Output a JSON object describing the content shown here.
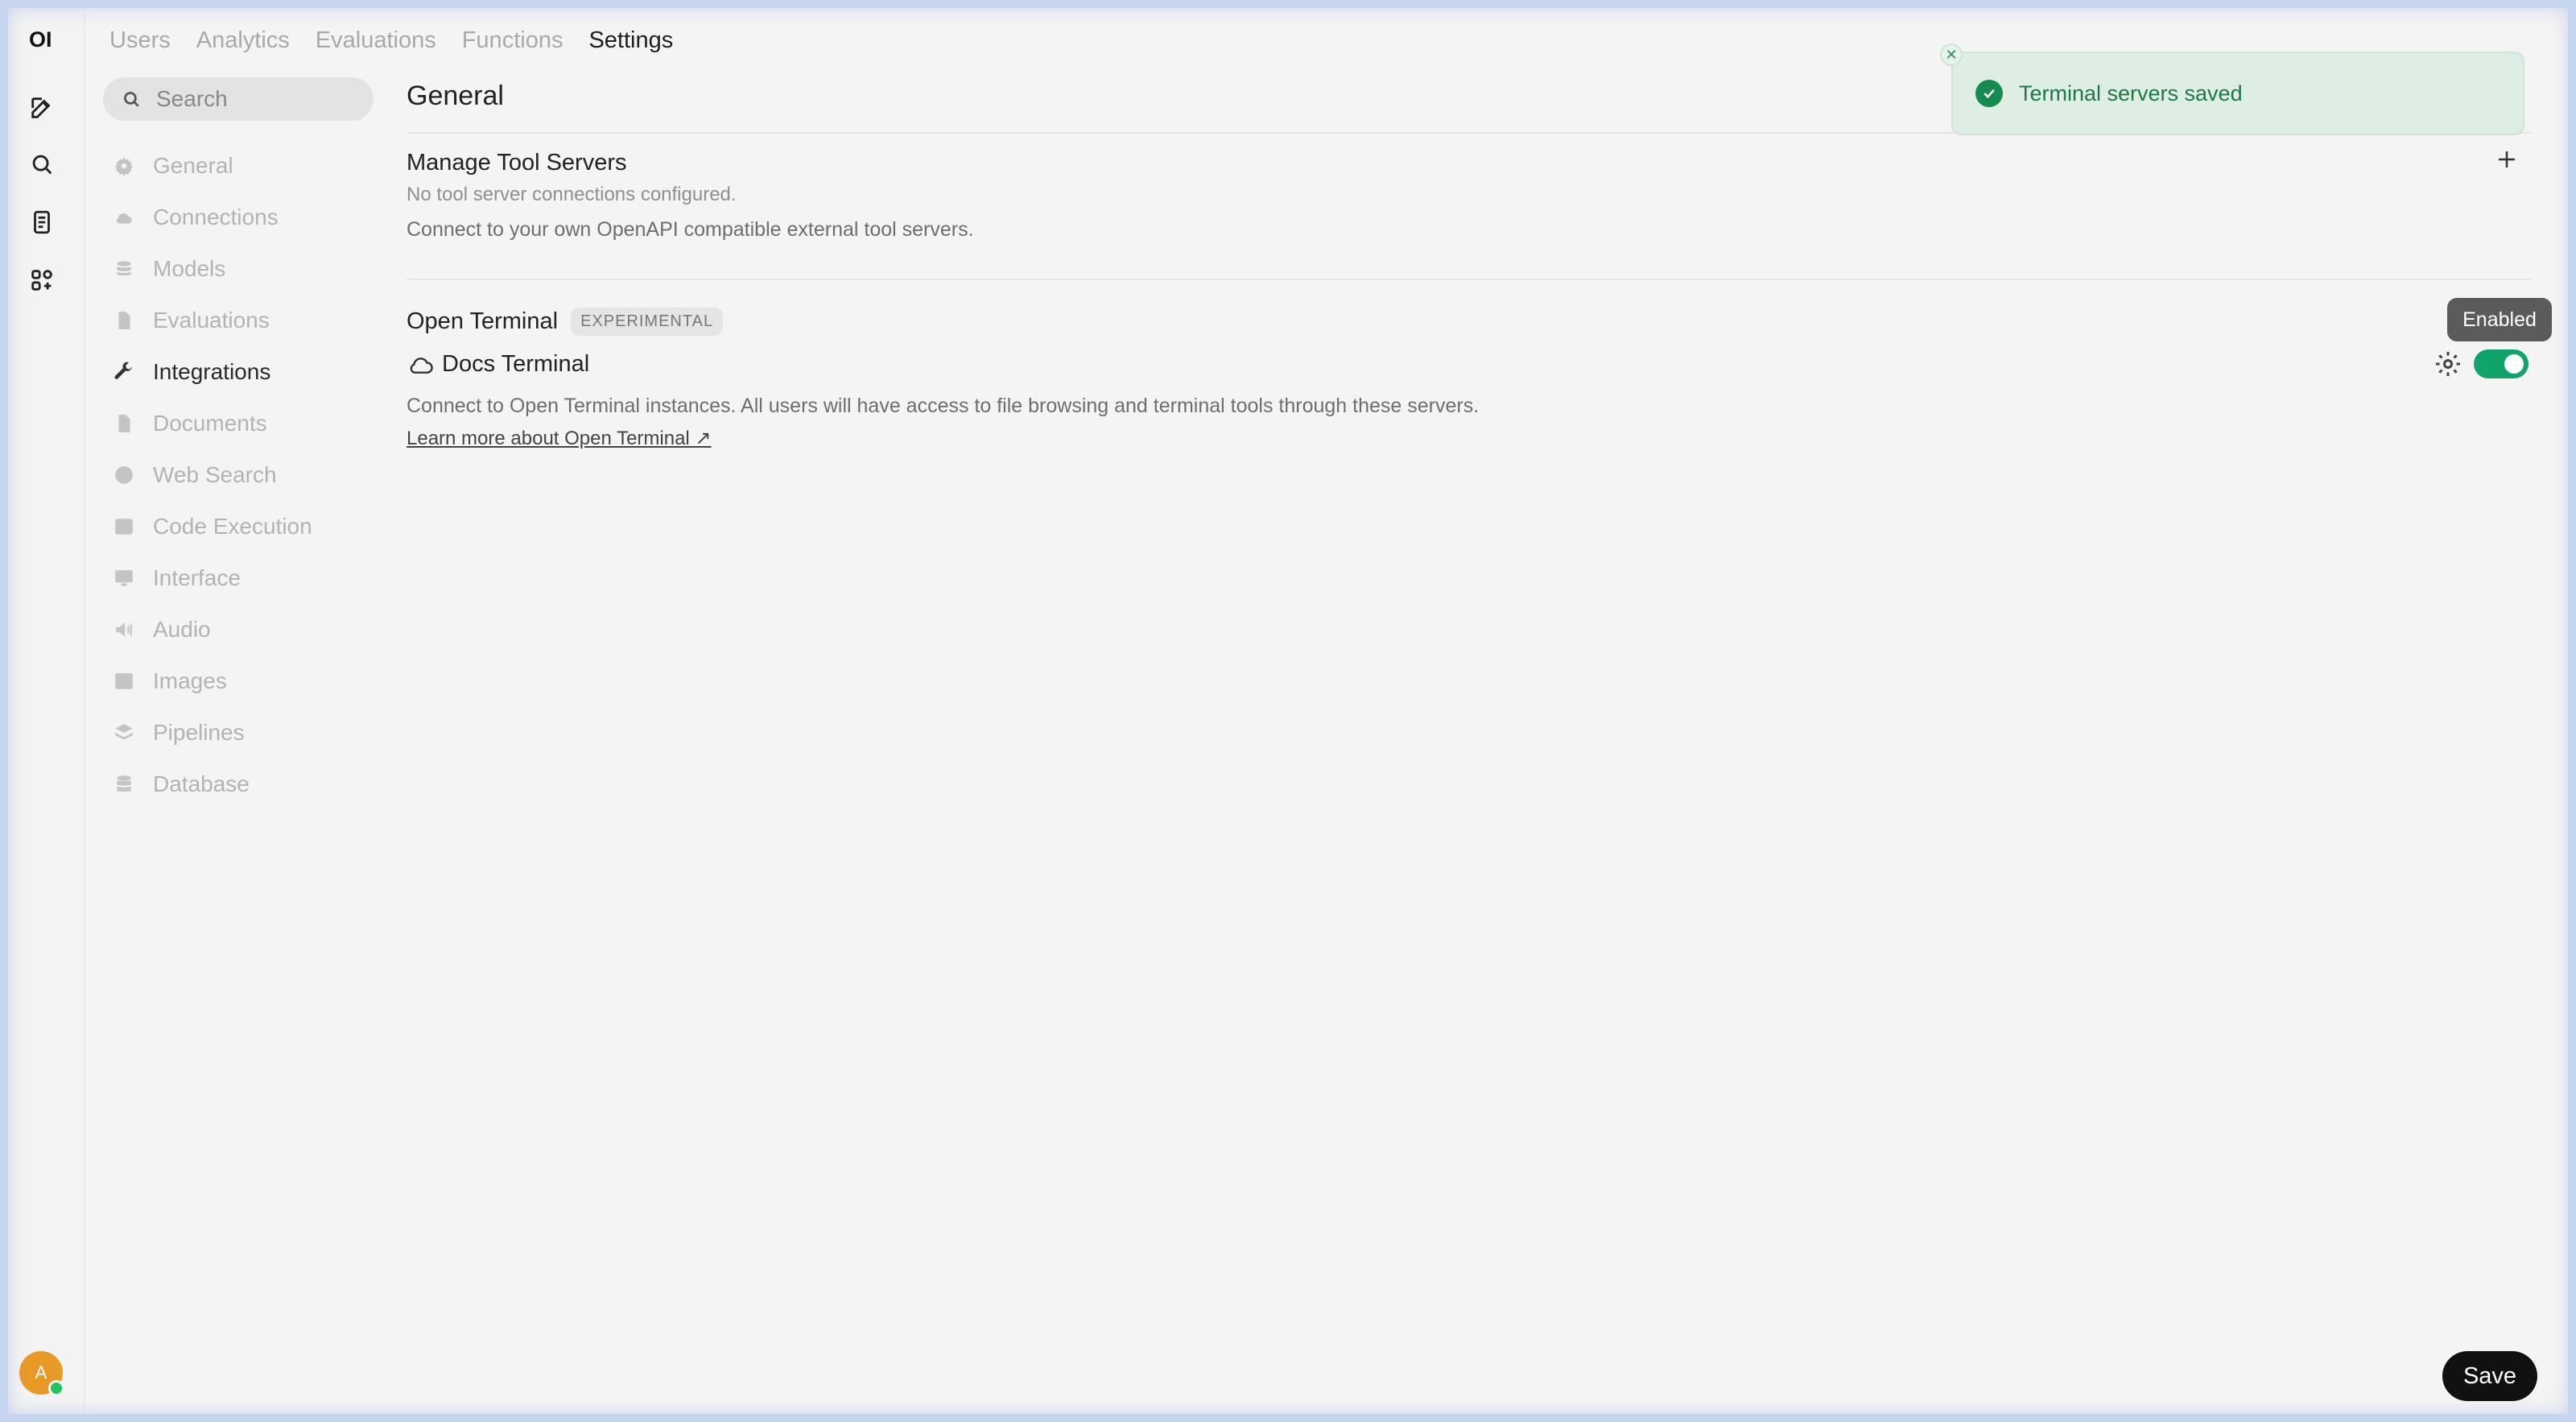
{
  "rail": {
    "logo": "OI",
    "icons": [
      "new-chat-icon",
      "search-icon",
      "notes-icon",
      "workspace-icon"
    ],
    "avatar_initial": "A"
  },
  "topnav": {
    "tabs": [
      {
        "label": "Users",
        "active": false
      },
      {
        "label": "Analytics",
        "active": false
      },
      {
        "label": "Evaluations",
        "active": false
      },
      {
        "label": "Functions",
        "active": false
      },
      {
        "label": "Settings",
        "active": true
      }
    ]
  },
  "sidebar": {
    "search_placeholder": "Search",
    "items": [
      {
        "label": "General",
        "icon": "gear-icon"
      },
      {
        "label": "Connections",
        "icon": "cloud-icon"
      },
      {
        "label": "Models",
        "icon": "stack-icon"
      },
      {
        "label": "Evaluations",
        "icon": "document-icon"
      },
      {
        "label": "Integrations",
        "icon": "wrench-icon",
        "active": true
      },
      {
        "label": "Documents",
        "icon": "document-icon"
      },
      {
        "label": "Web Search",
        "icon": "globe-icon"
      },
      {
        "label": "Code Execution",
        "icon": "terminal-icon"
      },
      {
        "label": "Interface",
        "icon": "monitor-icon"
      },
      {
        "label": "Audio",
        "icon": "speaker-icon"
      },
      {
        "label": "Images",
        "icon": "image-icon"
      },
      {
        "label": "Pipelines",
        "icon": "layers-icon"
      },
      {
        "label": "Database",
        "icon": "database-icon"
      }
    ]
  },
  "main": {
    "section_title": "General",
    "tool_servers": {
      "title": "Manage Tool Servers",
      "status": "No tool server connections configured.",
      "description": "Connect to your own OpenAPI compatible external tool servers."
    },
    "open_terminal": {
      "title": "Open Terminal",
      "badge": "EXPERIMENTAL",
      "server_name": "Docs Terminal",
      "description": "Connect to Open Terminal instances. All users will have access to file browsing and terminal tools through these servers.",
      "link": "Learn more about Open Terminal ↗",
      "enabled": true,
      "tooltip": "Enabled"
    }
  },
  "toast": {
    "message": "Terminal servers saved",
    "close_glyph": "✕"
  },
  "actions": {
    "save_label": "Save"
  },
  "colors": {
    "toggle_on": "#10a36a",
    "toast_bg": "#dfeee4",
    "toast_text": "#1a7a45",
    "avatar": "#e89a27"
  }
}
